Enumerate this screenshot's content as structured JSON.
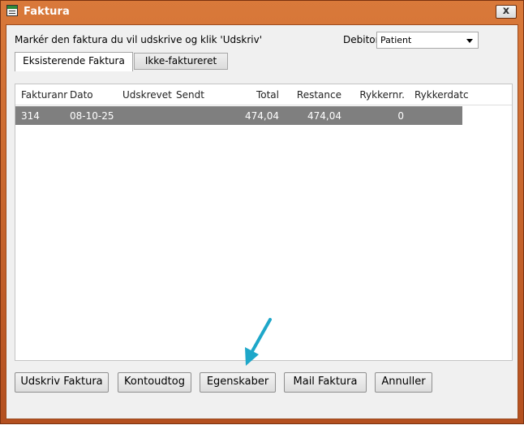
{
  "window": {
    "title": "Faktura",
    "close_label": "x"
  },
  "instruction": "Markér den faktura du vil udskrive og klik 'Udskriv'",
  "debitor": {
    "label": "Debitor",
    "selected": "Patient"
  },
  "tabs": [
    {
      "label": "Eksisterende Faktura",
      "active": true
    },
    {
      "label": "Ikke-faktureret",
      "active": false
    }
  ],
  "table": {
    "columns": [
      "Fakturanr",
      "Dato",
      "Udskrevet",
      "Sendt",
      "Total",
      "Restance",
      "Rykkernr.",
      "Rykkerdatc"
    ],
    "rows": [
      [
        "314",
        "08-10-25",
        "",
        "",
        "474,04",
        "474,04",
        "0",
        ""
      ]
    ]
  },
  "buttons": {
    "print": "Udskriv Faktura",
    "statement": "Kontoudtog",
    "properties": "Egenskaber",
    "mail": "Mail Faktura",
    "cancel": "Annuller"
  },
  "colors": {
    "title_bar": "#c9622b",
    "selected_row": "#7f7f7f",
    "annotation_arrow": "#1ea7c9"
  }
}
